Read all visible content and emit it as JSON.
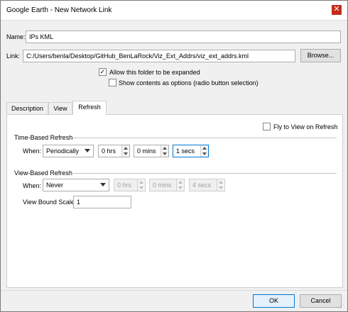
{
  "window": {
    "title": "Google Earth - New Network Link",
    "close_glyph": "✕"
  },
  "form": {
    "name_label": "Name:",
    "name_value": "IPs KML",
    "link_label": "Link:",
    "link_value": "C:/Users/benla/Desktop/GitHub_BenLaRock/Viz_Ext_Addrs/viz_ext_addrs.kml",
    "browse_label": "Browse...",
    "allow_expand_label": "Allow this folder to be expanded",
    "allow_expand_checked": true,
    "show_contents_label": "Show contents as options (radio button selection)",
    "show_contents_checked": false
  },
  "tabs": [
    {
      "label": "Description",
      "active": false
    },
    {
      "label": "View",
      "active": false
    },
    {
      "label": "Refresh",
      "active": true
    }
  ],
  "refresh": {
    "fly_to_view_label": "Fly to View on Refresh",
    "fly_to_view_checked": false,
    "time_based": {
      "section_label": "Time-Based Refresh",
      "when_label": "When:",
      "when_value": "Periodically",
      "hrs_value": "0 hrs",
      "mins_value": "0 mins",
      "secs_value": "1 secs"
    },
    "view_based": {
      "section_label": "View-Based Refresh",
      "when_label": "When:",
      "when_value": "Never",
      "hrs_value": "0 hrs",
      "mins_value": "0 mins",
      "secs_value": "4 secs",
      "scale_label": "View Bound Scale:",
      "scale_value": "1"
    }
  },
  "buttons": {
    "ok_label": "OK",
    "cancel_label": "Cancel"
  },
  "glyphs": {
    "check": "✓",
    "grip": "⋰"
  },
  "colors": {
    "accent": "#0078d7",
    "close": "#c42b1c"
  }
}
